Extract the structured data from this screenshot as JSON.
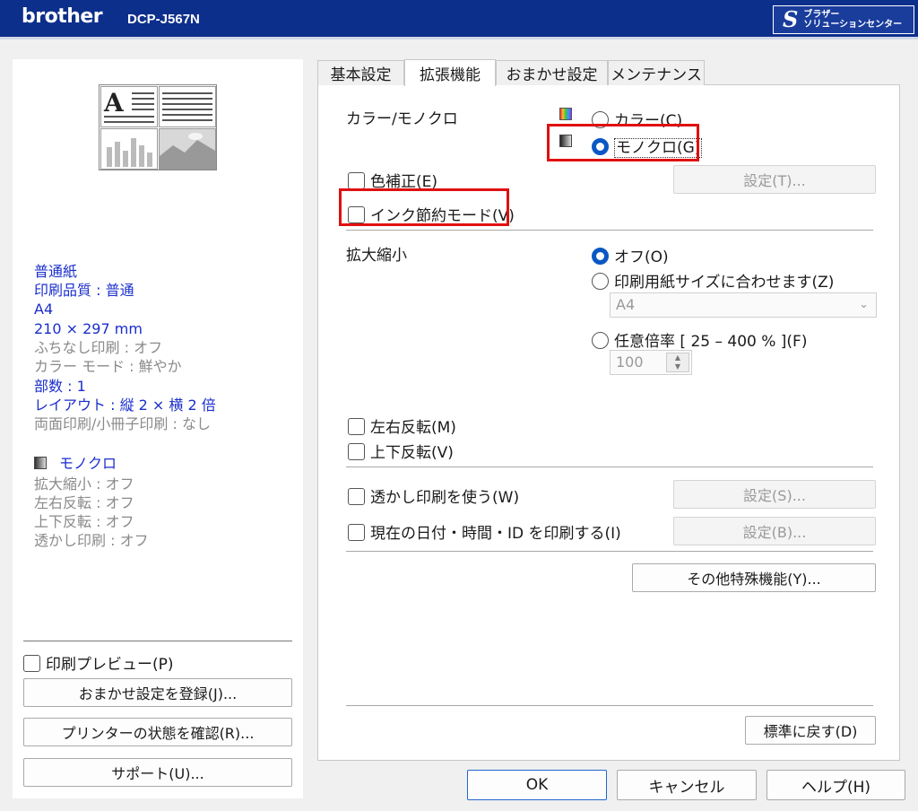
{
  "header": {
    "brand": "brother",
    "model": "DCP-J567N",
    "solutions_logo": "S",
    "solutions_line1": "ブラザー",
    "solutions_line2": "ソリューションセンター"
  },
  "left": {
    "summary": [
      {
        "text": "普通紙",
        "style": "blue"
      },
      {
        "text": "印刷品質 : 普通",
        "style": "blue"
      },
      {
        "text": "A4",
        "style": "blue"
      },
      {
        "text": "210 × 297 mm",
        "style": "blue"
      },
      {
        "text": "ふちなし印刷 : オフ",
        "style": "gray"
      },
      {
        "text": "カラー モード : 鮮やか",
        "style": "gray"
      },
      {
        "text": "部数 : 1",
        "style": "blue"
      },
      {
        "text": "レイアウト : 縦 2 × 横 2 倍",
        "style": "blue"
      },
      {
        "text": "両面印刷/小冊子印刷 : なし",
        "style": "gray"
      }
    ],
    "mono_label": "モノクロ",
    "summary2": [
      "拡大縮小 : オフ",
      "左右反転 : オフ",
      "上下反転 : オフ",
      "透かし印刷 : オフ"
    ],
    "print_preview_label": "印刷プレビュー(P)",
    "print_preview_checked": false,
    "register_button": "おまかせ設定を登録(J)...",
    "status_button": "プリンターの状態を確認(R)...",
    "support_button": "サポート(U)..."
  },
  "tabs": [
    "基本設定",
    "拡張機能",
    "おまかせ設定",
    "メンテナンス"
  ],
  "active_tab": "拡張機能",
  "panel": {
    "color_mono_label": "カラー/モノクロ",
    "color_option": "カラー(C)",
    "mono_option": "モノクロ(G)",
    "selected_color_mode": "モノクロ(G)",
    "color_correction": "色補正(E)",
    "color_correction_settings": "設定(T)...",
    "ink_save": "インク節約モード(V)",
    "scaling_label": "拡大縮小",
    "scaling_off": "オフ(O)",
    "scaling_fit": "印刷用紙サイズに合わせます(Z)",
    "paper_size_value": "A4",
    "scaling_custom": "任意倍率 [ 25 – 400 % ](F)",
    "scale_value": "100",
    "selected_scaling": "オフ(O)",
    "mirror": "左右反転(M)",
    "reverse": "上下反転(V)",
    "watermark": "透かし印刷を使う(W)",
    "watermark_settings": "設定(S)...",
    "header_footer": "現在の日付・時間・ID を印刷する(I)",
    "header_footer_settings": "設定(B)...",
    "other_features": "その他特殊機能(Y)...",
    "defaults": "標準に戻す(D)"
  },
  "footer": {
    "ok": "OK",
    "cancel": "キャンセル",
    "help": "ヘルプ(H)"
  },
  "colors": {
    "header_bg": "#0d2f8c",
    "highlight": "#e01010",
    "radio_selected": "#0b58c4",
    "summary_blue": "#1a2ecc"
  }
}
